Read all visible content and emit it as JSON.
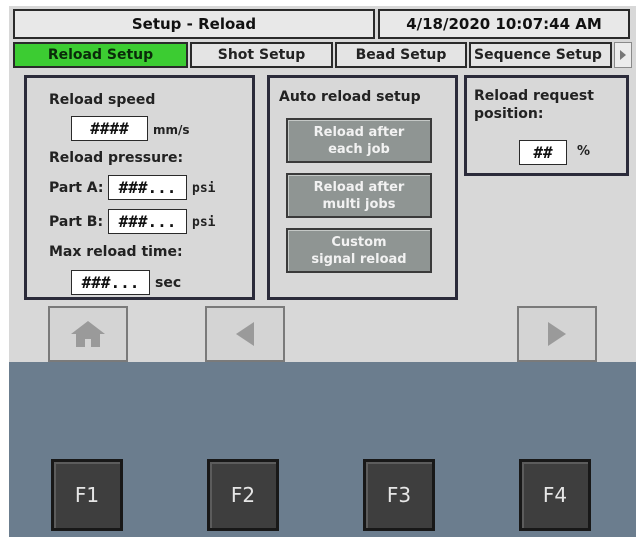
{
  "header": {
    "title": "Setup - Reload",
    "datetime": "4/18/2020 10:07:44 AM"
  },
  "tabs": [
    {
      "label": "Reload Setup",
      "active": true
    },
    {
      "label": "Shot Setup",
      "active": false
    },
    {
      "label": "Bead Setup",
      "active": false
    },
    {
      "label": "Sequence Setup",
      "active": false
    }
  ],
  "reload_panel": {
    "speed_label": "Reload speed",
    "speed_value": "####",
    "speed_unit": "mm/s",
    "pressure_label": "Reload pressure:",
    "part_a_label": "Part A:",
    "part_a_value": "###...",
    "part_a_unit": "psi",
    "part_b_label": "Part B:",
    "part_b_value": "###...",
    "part_b_unit": "psi",
    "max_time_label": "Max reload time:",
    "max_time_value": "###...",
    "max_time_unit": "sec"
  },
  "auto_panel": {
    "title": "Auto reload setup",
    "buttons": [
      {
        "line1": "Reload after",
        "line2": "each job"
      },
      {
        "line1": "Reload after",
        "line2": "multi jobs"
      },
      {
        "line1": "Custom",
        "line2": "signal reload"
      }
    ]
  },
  "request_panel": {
    "label_line1": "Reload request",
    "label_line2": "position:",
    "value": "##",
    "unit": "%"
  },
  "nav": {
    "home": "home-icon",
    "back": "arrow-left-icon",
    "forward": "arrow-right-icon"
  },
  "fkeys": [
    "F1",
    "F2",
    "F3",
    "F4"
  ],
  "colors": {
    "active_tab": "#3ccc32",
    "bezel": "#6b7d8e",
    "screen": "#d8d8d8",
    "option_button": "#8f9593"
  }
}
